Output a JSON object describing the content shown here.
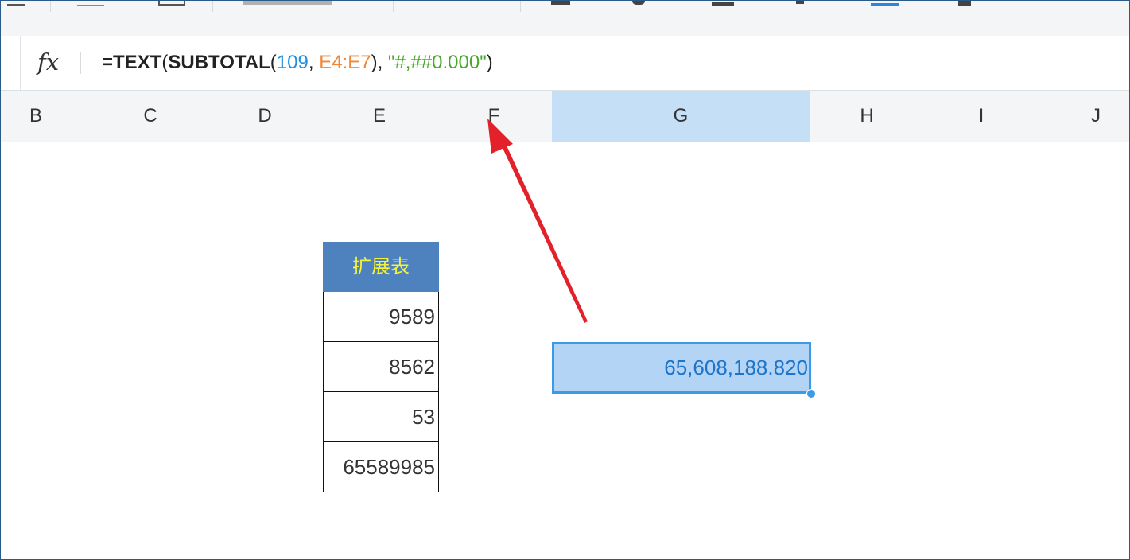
{
  "formula_bar": {
    "fx_label": "fx",
    "formula_parts": {
      "prefix": "=",
      "fn1": "TEXT",
      "open1": "(",
      "fn2": "SUBTOTAL",
      "open2": "(",
      "arg1": "109",
      "comma1": ", ",
      "arg2": "E4:E7",
      "close2": "),",
      "space": " ",
      "arg3": "\"#,##0.000\"",
      "close1": ")"
    }
  },
  "columns": [
    "B",
    "C",
    "D",
    "E",
    "F",
    "G",
    "H",
    "I",
    "J"
  ],
  "selected_column": "G",
  "ext_table": {
    "header": "扩展表",
    "values": [
      "9589",
      "8562",
      "53",
      "65589985"
    ]
  },
  "result_cell": {
    "value": "65,608,188.820"
  },
  "colors": {
    "selection_fill": "#b3d4f5",
    "selection_border": "#3c9be6",
    "header_fill": "#4e82bf",
    "header_text": "#f5f23a",
    "arrow": "#e3212b"
  }
}
